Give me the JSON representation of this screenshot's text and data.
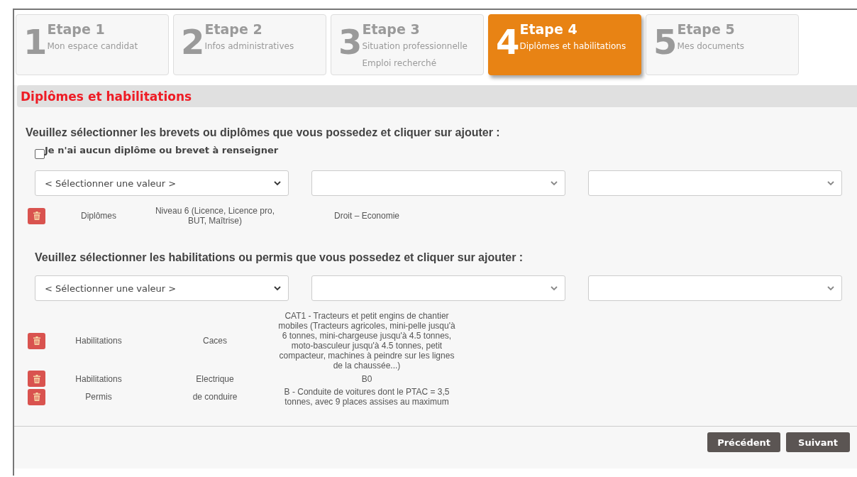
{
  "steps": [
    {
      "number": "1",
      "title": "Etape 1",
      "subtitle": "Mon espace candidat",
      "selected": false
    },
    {
      "number": "2",
      "title": "Etape 2",
      "subtitle": "Infos administratives",
      "selected": false
    },
    {
      "number": "3",
      "title": "Etape 3",
      "subtitle": "Situation professionnelle Emploi recherché",
      "selected": false
    },
    {
      "number": "4",
      "title": "Etape 4",
      "subtitle": "Diplômes et habilitations",
      "selected": true
    },
    {
      "number": "5",
      "title": "Etape 5",
      "subtitle": "Mes documents",
      "selected": false
    }
  ],
  "section_title": "Diplômes et habilitations",
  "diplomas": {
    "instruction": "Veuillez sélectionner les brevets ou diplômes que vous possedez et cliquer sur ajouter :",
    "none_checkbox": {
      "label": "Je n'ai aucun diplôme ou brevet à renseigner",
      "checked": false
    },
    "selects": [
      {
        "kind": "filled",
        "value": "< Sélectionner une valeur >"
      },
      {
        "kind": "empty"
      },
      {
        "kind": "empty"
      }
    ],
    "items": [
      {
        "column_1": "Diplômes",
        "column_2": "Niveau 6 (Licence, Licence pro, BUT, Maîtrise)",
        "column_3": "Droit – Economie"
      }
    ]
  },
  "habilitations": {
    "instruction": "Veuillez sélectionner les habilitations ou permis que vous possedez et cliquer sur ajouter :",
    "selects": [
      {
        "kind": "filled",
        "value": "< Sélectionner une valeur >"
      },
      {
        "kind": "empty"
      },
      {
        "kind": "empty"
      }
    ],
    "items": [
      {
        "column_1": "Habilitations",
        "column_2": "Caces",
        "column_3": "CAT1 - Tracteurs et petit engins de chantier mobiles (Tracteurs agricoles, mini-pelle jusqu'à 6 tonnes, mini-chargeuse jusqu'à 4.5 tonnes, moto-basculeur jusqu'à 4.5 tonnes, petit compacteur, machines à peindre sur les lignes de la chaussée...)"
      },
      {
        "column_1": "Habilitations",
        "column_2": "Electrique",
        "column_3": "B0"
      },
      {
        "column_1": "Permis",
        "column_2": "de conduire",
        "column_3": "B - Conduite de voitures dont le PTAC = 3,5 tonnes, avec 9 places assises au maximum"
      }
    ]
  },
  "buttons": [
    "Précédent",
    "Suivant"
  ]
}
